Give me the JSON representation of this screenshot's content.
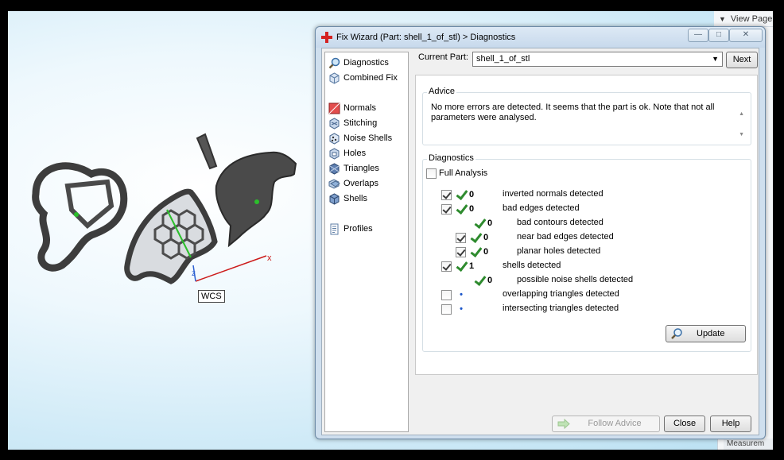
{
  "viewport": {
    "view_page": "View Page",
    "measurement": "Measurem",
    "wcs": "WCS",
    "axis_x": "x",
    "axis_z": "z"
  },
  "dialog": {
    "title": "Fix Wizard (Part: shell_1_of_stl) > Diagnostics",
    "nav": [
      {
        "label": "Diagnostics",
        "icon": "magnifier-icon"
      },
      {
        "label": "Combined Fix",
        "icon": "cube-icon"
      },
      {
        "label": "Normals",
        "icon": "normals-icon"
      },
      {
        "label": "Stitching",
        "icon": "stitching-icon"
      },
      {
        "label": "Noise Shells",
        "icon": "noise-shells-icon"
      },
      {
        "label": "Holes",
        "icon": "holes-icon"
      },
      {
        "label": "Triangles",
        "icon": "triangles-icon"
      },
      {
        "label": "Overlaps",
        "icon": "overlaps-icon"
      },
      {
        "label": "Shells",
        "icon": "shells-icon"
      },
      {
        "label": "Profiles",
        "icon": "profiles-icon"
      }
    ],
    "current_part_label": "Current Part:",
    "current_part_value": "shell_1_of_stl",
    "next_label": "Next",
    "advice_title": "Advice",
    "advice_text": "No more errors are detected. It seems that the part is ok. Note that not all parameters were analysed.",
    "diagnostics_title": "Diagnostics",
    "full_analysis_label": "Full Analysis",
    "items": [
      {
        "label": "inverted normals detected",
        "count": "0",
        "checked": true,
        "status": "ok"
      },
      {
        "label": "bad edges detected",
        "count": "0",
        "checked": true,
        "status": "ok"
      },
      {
        "label": "bad contours detected",
        "count": "0",
        "checked": null,
        "status": "ok"
      },
      {
        "label": "near bad edges detected",
        "count": "0",
        "checked": true,
        "status": "ok"
      },
      {
        "label": "planar holes detected",
        "count": "0",
        "checked": true,
        "status": "ok"
      },
      {
        "label": "shells detected",
        "count": "1",
        "checked": true,
        "status": "ok"
      },
      {
        "label": "possible noise shells detected",
        "count": "0",
        "checked": null,
        "status": "ok"
      },
      {
        "label": "overlapping triangles detected",
        "count": "",
        "checked": false,
        "status": "not-run"
      },
      {
        "label": "intersecting triangles detected",
        "count": "",
        "checked": false,
        "status": "not-run"
      }
    ],
    "update_label": "Update",
    "follow_advice_label": "Follow Advice",
    "close_label": "Close",
    "help_label": "Help",
    "window_buttons": {
      "minimize": "—",
      "maximize": "□",
      "close": "✕"
    }
  }
}
